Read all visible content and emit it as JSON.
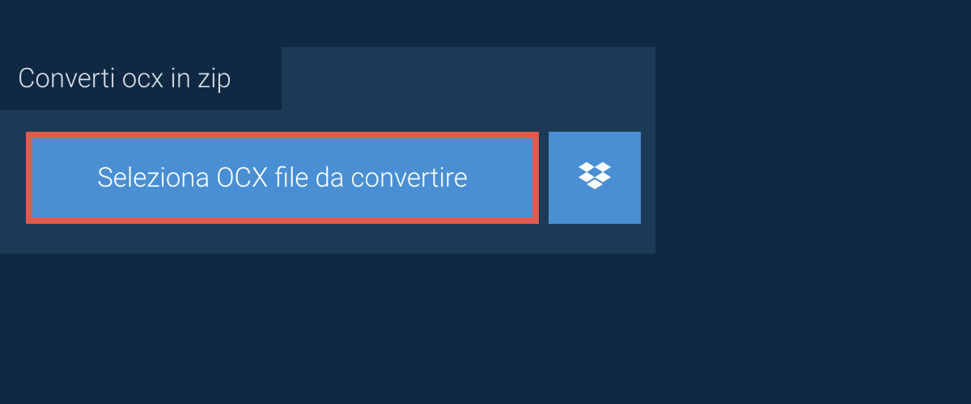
{
  "tab": {
    "title": "Converti ocx in zip"
  },
  "actions": {
    "select_file_label": "Seleziona OCX file da convertire",
    "dropbox_icon": "dropbox-icon"
  },
  "colors": {
    "page_bg": "#0f2942",
    "panel_bg": "#1a3a56",
    "button_bg": "#4a8fd3",
    "button_highlight_border": "#e15a4f",
    "text_light": "#d8dfe6",
    "text_white": "#ffffff"
  }
}
